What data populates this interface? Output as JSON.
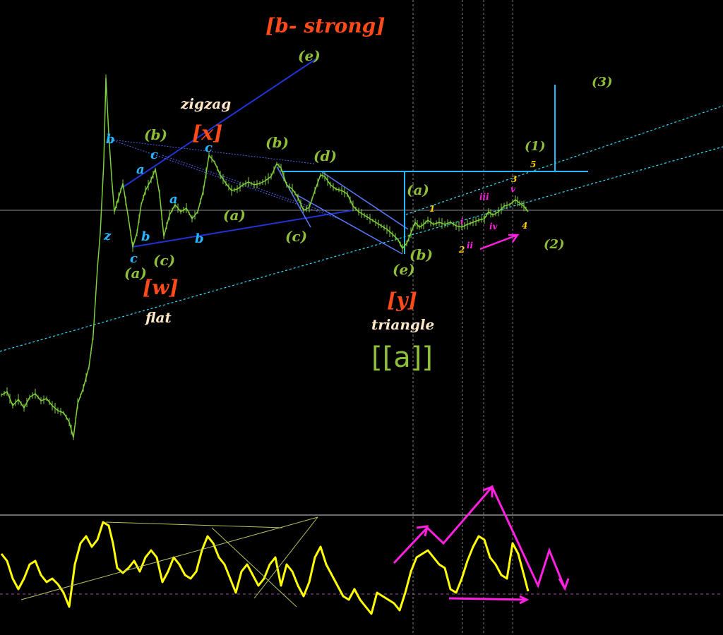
{
  "chart_data": {
    "type": "line",
    "colors": {
      "candles": "#7fd13b",
      "oscillator": "#ffff00",
      "orange": "#ff4a1a",
      "olive": "#8fbf3a",
      "cyan": "#27b7ff",
      "blue": "#1414c8",
      "magenta": "#ff20e0",
      "yellow": "#ffd000",
      "cream": "#ffe7c7",
      "dashed_channel": "#2fe0ff",
      "trendline": "#2030d0",
      "level": "#20b8ff"
    },
    "wave_labels": [
      {
        "id": "b-strong",
        "text": "[b- strong]",
        "color": "orange",
        "size": "big"
      },
      {
        "id": "e-top",
        "text": "(e)",
        "color": "olive",
        "size": "mid"
      },
      {
        "id": "zigzag",
        "text": "zigzag",
        "color": "cream",
        "size": "mid"
      },
      {
        "id": "x",
        "text": "[x]",
        "color": "orange",
        "size": "big"
      },
      {
        "id": "b-left",
        "text": "(b)",
        "color": "olive",
        "size": "mid"
      },
      {
        "id": "b-mid",
        "text": "(b)",
        "color": "olive",
        "size": "mid"
      },
      {
        "id": "d",
        "text": "(d)",
        "color": "olive",
        "size": "mid"
      },
      {
        "id": "three-top",
        "text": "(3)",
        "color": "olive",
        "size": "sm"
      },
      {
        "id": "one-top",
        "text": "(1)",
        "color": "olive",
        "size": "sm"
      },
      {
        "id": "five",
        "text": "5",
        "color": "yellow",
        "size": "xs"
      },
      {
        "id": "three-small",
        "text": "3",
        "color": "yellow",
        "size": "xs"
      },
      {
        "id": "v",
        "text": "v",
        "color": "magenta",
        "size": "xs"
      },
      {
        "id": "iii",
        "text": "iii",
        "color": "magenta",
        "size": "xs"
      },
      {
        "id": "i",
        "text": "i",
        "color": "magenta",
        "size": "xs"
      },
      {
        "id": "one-small",
        "text": "1",
        "color": "yellow",
        "size": "xs"
      },
      {
        "id": "iv",
        "text": "iv",
        "color": "magenta",
        "size": "xs"
      },
      {
        "id": "four",
        "text": "4",
        "color": "yellow",
        "size": "xs"
      },
      {
        "id": "ii",
        "text": "ii",
        "color": "magenta",
        "size": "xs"
      },
      {
        "id": "two-small",
        "text": "2",
        "color": "yellow",
        "size": "xs"
      },
      {
        "id": "two-right",
        "text": "(2)",
        "color": "olive",
        "size": "sm"
      },
      {
        "id": "a-right",
        "text": "(a)",
        "color": "olive",
        "size": "mid"
      },
      {
        "id": "b-right",
        "text": "(b)",
        "color": "olive",
        "size": "mid"
      },
      {
        "id": "e-bottom",
        "text": "(e)",
        "color": "olive",
        "size": "mid"
      },
      {
        "id": "y",
        "text": "[y]",
        "color": "orange",
        "size": "big"
      },
      {
        "id": "triangle",
        "text": "triangle",
        "color": "cream",
        "size": "mid"
      },
      {
        "id": "a-mid",
        "text": "(a)",
        "color": "olive",
        "size": "mid"
      },
      {
        "id": "c-mid",
        "text": "(c)",
        "color": "olive",
        "size": "mid"
      },
      {
        "id": "b-cyan-1",
        "text": "b",
        "color": "cyan",
        "size": "sm"
      },
      {
        "id": "c-cyan-1",
        "text": "c",
        "color": "cyan",
        "size": "sm"
      },
      {
        "id": "a-cyan-1",
        "text": "a",
        "color": "cyan",
        "size": "sm"
      },
      {
        "id": "z",
        "text": "z",
        "color": "cyan",
        "size": "sm"
      },
      {
        "id": "b-cyan-2",
        "text": "b",
        "color": "cyan",
        "size": "sm"
      },
      {
        "id": "c-cyan-2",
        "text": "c",
        "color": "cyan",
        "size": "sm"
      },
      {
        "id": "a-cyan-2",
        "text": "a",
        "color": "cyan",
        "size": "sm"
      },
      {
        "id": "b-cyan-3",
        "text": "b",
        "color": "cyan",
        "size": "sm"
      },
      {
        "id": "c-cyan-3",
        "text": "c",
        "color": "cyan",
        "size": "sm"
      },
      {
        "id": "a-left",
        "text": "(a)",
        "color": "olive",
        "size": "mid"
      },
      {
        "id": "c-left",
        "text": "(c)",
        "color": "olive",
        "size": "mid"
      },
      {
        "id": "w",
        "text": "[w]",
        "color": "orange",
        "size": "big"
      },
      {
        "id": "flat",
        "text": "flat",
        "color": "cream",
        "size": "mid"
      },
      {
        "id": "aa",
        "text": "[[a]]",
        "color": "olive",
        "size": "wave"
      }
    ],
    "price_series": [
      {
        "bar": 0,
        "price": 560
      },
      {
        "bar": 8,
        "price": 555
      },
      {
        "bar": 16,
        "price": 575
      },
      {
        "bar": 24,
        "price": 566
      },
      {
        "bar": 32,
        "price": 578
      },
      {
        "bar": 40,
        "price": 563
      },
      {
        "bar": 48,
        "price": 558
      },
      {
        "bar": 56,
        "price": 568
      },
      {
        "bar": 64,
        "price": 565
      },
      {
        "bar": 72,
        "price": 575
      },
      {
        "bar": 80,
        "price": 582
      },
      {
        "bar": 88,
        "price": 585
      },
      {
        "bar": 96,
        "price": 598
      },
      {
        "bar": 102,
        "price": 620
      },
      {
        "bar": 108,
        "price": 572
      },
      {
        "bar": 116,
        "price": 550
      },
      {
        "bar": 124,
        "price": 520
      },
      {
        "bar": 130,
        "price": 475
      },
      {
        "bar": 136,
        "price": 380
      },
      {
        "bar": 140,
        "price": 330
      },
      {
        "bar": 145,
        "price": 230
      },
      {
        "bar": 148,
        "price": 110
      },
      {
        "bar": 152,
        "price": 190
      },
      {
        "bar": 156,
        "price": 250
      },
      {
        "bar": 160,
        "price": 300
      },
      {
        "bar": 166,
        "price": 280
      },
      {
        "bar": 172,
        "price": 260
      },
      {
        "bar": 180,
        "price": 310
      },
      {
        "bar": 186,
        "price": 350
      },
      {
        "bar": 192,
        "price": 330
      },
      {
        "bar": 198,
        "price": 290
      },
      {
        "bar": 204,
        "price": 270
      },
      {
        "bar": 212,
        "price": 255
      },
      {
        "bar": 218,
        "price": 240
      },
      {
        "bar": 224,
        "price": 275
      },
      {
        "bar": 230,
        "price": 335
      },
      {
        "bar": 238,
        "price": 305
      },
      {
        "bar": 246,
        "price": 290
      },
      {
        "bar": 254,
        "price": 300
      },
      {
        "bar": 262,
        "price": 295
      },
      {
        "bar": 270,
        "price": 310
      },
      {
        "bar": 278,
        "price": 300
      },
      {
        "bar": 286,
        "price": 270
      },
      {
        "bar": 294,
        "price": 220
      },
      {
        "bar": 302,
        "price": 230
      },
      {
        "bar": 310,
        "price": 248
      },
      {
        "bar": 318,
        "price": 260
      },
      {
        "bar": 326,
        "price": 270
      },
      {
        "bar": 334,
        "price": 268
      },
      {
        "bar": 342,
        "price": 262
      },
      {
        "bar": 350,
        "price": 258
      },
      {
        "bar": 358,
        "price": 262
      },
      {
        "bar": 366,
        "price": 260
      },
      {
        "bar": 374,
        "price": 256
      },
      {
        "bar": 382,
        "price": 250
      },
      {
        "bar": 390,
        "price": 232
      },
      {
        "bar": 396,
        "price": 238
      },
      {
        "bar": 404,
        "price": 262
      },
      {
        "bar": 412,
        "price": 268
      },
      {
        "bar": 420,
        "price": 280
      },
      {
        "bar": 428,
        "price": 298
      },
      {
        "bar": 436,
        "price": 294
      },
      {
        "bar": 444,
        "price": 270
      },
      {
        "bar": 452,
        "price": 248
      },
      {
        "bar": 458,
        "price": 250
      },
      {
        "bar": 466,
        "price": 262
      },
      {
        "bar": 474,
        "price": 268
      },
      {
        "bar": 482,
        "price": 270
      },
      {
        "bar": 490,
        "price": 275
      },
      {
        "bar": 498,
        "price": 292
      },
      {
        "bar": 506,
        "price": 300
      },
      {
        "bar": 514,
        "price": 305
      },
      {
        "bar": 522,
        "price": 310
      },
      {
        "bar": 530,
        "price": 315
      },
      {
        "bar": 538,
        "price": 320
      },
      {
        "bar": 546,
        "price": 325
      },
      {
        "bar": 554,
        "price": 332
      },
      {
        "bar": 562,
        "price": 340
      },
      {
        "bar": 568,
        "price": 352
      },
      {
        "bar": 574,
        "price": 345
      },
      {
        "bar": 580,
        "price": 330
      },
      {
        "bar": 586,
        "price": 315
      },
      {
        "bar": 592,
        "price": 322
      },
      {
        "bar": 598,
        "price": 318
      },
      {
        "bar": 604,
        "price": 312
      },
      {
        "bar": 612,
        "price": 318
      },
      {
        "bar": 620,
        "price": 315
      },
      {
        "bar": 628,
        "price": 318
      },
      {
        "bar": 636,
        "price": 315
      },
      {
        "bar": 644,
        "price": 320
      },
      {
        "bar": 652,
        "price": 322
      },
      {
        "bar": 660,
        "price": 318
      },
      {
        "bar": 668,
        "price": 315
      },
      {
        "bar": 676,
        "price": 312
      },
      {
        "bar": 684,
        "price": 310
      },
      {
        "bar": 690,
        "price": 300
      },
      {
        "bar": 696,
        "price": 305
      },
      {
        "bar": 704,
        "price": 300
      },
      {
        "bar": 712,
        "price": 292
      },
      {
        "bar": 720,
        "price": 290
      },
      {
        "bar": 728,
        "price": 283
      },
      {
        "bar": 734,
        "price": 288
      },
      {
        "bar": 740,
        "price": 292
      },
      {
        "bar": 746,
        "price": 300
      }
    ],
    "oscillator_series": [
      {
        "bar": 0,
        "value": 785
      },
      {
        "bar": 8,
        "value": 795
      },
      {
        "bar": 16,
        "value": 820
      },
      {
        "bar": 24,
        "value": 835
      },
      {
        "bar": 32,
        "value": 820
      },
      {
        "bar": 40,
        "value": 800
      },
      {
        "bar": 48,
        "value": 795
      },
      {
        "bar": 56,
        "value": 815
      },
      {
        "bar": 64,
        "value": 825
      },
      {
        "bar": 72,
        "value": 820
      },
      {
        "bar": 80,
        "value": 828
      },
      {
        "bar": 88,
        "value": 840
      },
      {
        "bar": 96,
        "value": 860
      },
      {
        "bar": 104,
        "value": 800
      },
      {
        "bar": 112,
        "value": 770
      },
      {
        "bar": 120,
        "value": 760
      },
      {
        "bar": 128,
        "value": 775
      },
      {
        "bar": 136,
        "value": 765
      },
      {
        "bar": 144,
        "value": 740
      },
      {
        "bar": 152,
        "value": 745
      },
      {
        "bar": 158,
        "value": 770
      },
      {
        "bar": 164,
        "value": 805
      },
      {
        "bar": 172,
        "value": 812
      },
      {
        "bar": 180,
        "value": 805
      },
      {
        "bar": 188,
        "value": 795
      },
      {
        "bar": 196,
        "value": 810
      },
      {
        "bar": 204,
        "value": 790
      },
      {
        "bar": 212,
        "value": 780
      },
      {
        "bar": 220,
        "value": 790
      },
      {
        "bar": 228,
        "value": 825
      },
      {
        "bar": 236,
        "value": 810
      },
      {
        "bar": 244,
        "value": 790
      },
      {
        "bar": 252,
        "value": 800
      },
      {
        "bar": 260,
        "value": 815
      },
      {
        "bar": 268,
        "value": 820
      },
      {
        "bar": 276,
        "value": 810
      },
      {
        "bar": 284,
        "value": 780
      },
      {
        "bar": 292,
        "value": 760
      },
      {
        "bar": 300,
        "value": 770
      },
      {
        "bar": 308,
        "value": 790
      },
      {
        "bar": 316,
        "value": 800
      },
      {
        "bar": 324,
        "value": 820
      },
      {
        "bar": 332,
        "value": 840
      },
      {
        "bar": 340,
        "value": 810
      },
      {
        "bar": 348,
        "value": 800
      },
      {
        "bar": 356,
        "value": 815
      },
      {
        "bar": 364,
        "value": 830
      },
      {
        "bar": 372,
        "value": 820
      },
      {
        "bar": 380,
        "value": 800
      },
      {
        "bar": 388,
        "value": 790
      },
      {
        "bar": 396,
        "value": 830
      },
      {
        "bar": 404,
        "value": 800
      },
      {
        "bar": 412,
        "value": 810
      },
      {
        "bar": 420,
        "value": 830
      },
      {
        "bar": 428,
        "value": 845
      },
      {
        "bar": 436,
        "value": 825
      },
      {
        "bar": 444,
        "value": 790
      },
      {
        "bar": 452,
        "value": 775
      },
      {
        "bar": 460,
        "value": 800
      },
      {
        "bar": 468,
        "value": 815
      },
      {
        "bar": 476,
        "value": 830
      },
      {
        "bar": 484,
        "value": 845
      },
      {
        "bar": 492,
        "value": 850
      },
      {
        "bar": 500,
        "value": 835
      },
      {
        "bar": 508,
        "value": 850
      },
      {
        "bar": 516,
        "value": 860
      },
      {
        "bar": 524,
        "value": 870
      },
      {
        "bar": 532,
        "value": 840
      },
      {
        "bar": 540,
        "value": 845
      },
      {
        "bar": 548,
        "value": 850
      },
      {
        "bar": 556,
        "value": 855
      },
      {
        "bar": 564,
        "value": 865
      },
      {
        "bar": 572,
        "value": 840
      },
      {
        "bar": 580,
        "value": 810
      },
      {
        "bar": 588,
        "value": 790
      },
      {
        "bar": 596,
        "value": 785
      },
      {
        "bar": 604,
        "value": 780
      },
      {
        "bar": 612,
        "value": 790
      },
      {
        "bar": 620,
        "value": 800
      },
      {
        "bar": 628,
        "value": 805
      },
      {
        "bar": 636,
        "value": 835
      },
      {
        "bar": 644,
        "value": 840
      },
      {
        "bar": 652,
        "value": 820
      },
      {
        "bar": 660,
        "value": 795
      },
      {
        "bar": 668,
        "value": 775
      },
      {
        "bar": 676,
        "value": 760
      },
      {
        "bar": 684,
        "value": 765
      },
      {
        "bar": 692,
        "value": 790
      },
      {
        "bar": 700,
        "value": 800
      },
      {
        "bar": 708,
        "value": 815
      },
      {
        "bar": 716,
        "value": 820
      },
      {
        "bar": 724,
        "value": 770
      },
      {
        "bar": 732,
        "value": 785
      },
      {
        "bar": 740,
        "value": 815
      },
      {
        "bar": 746,
        "value": 838
      }
    ]
  }
}
